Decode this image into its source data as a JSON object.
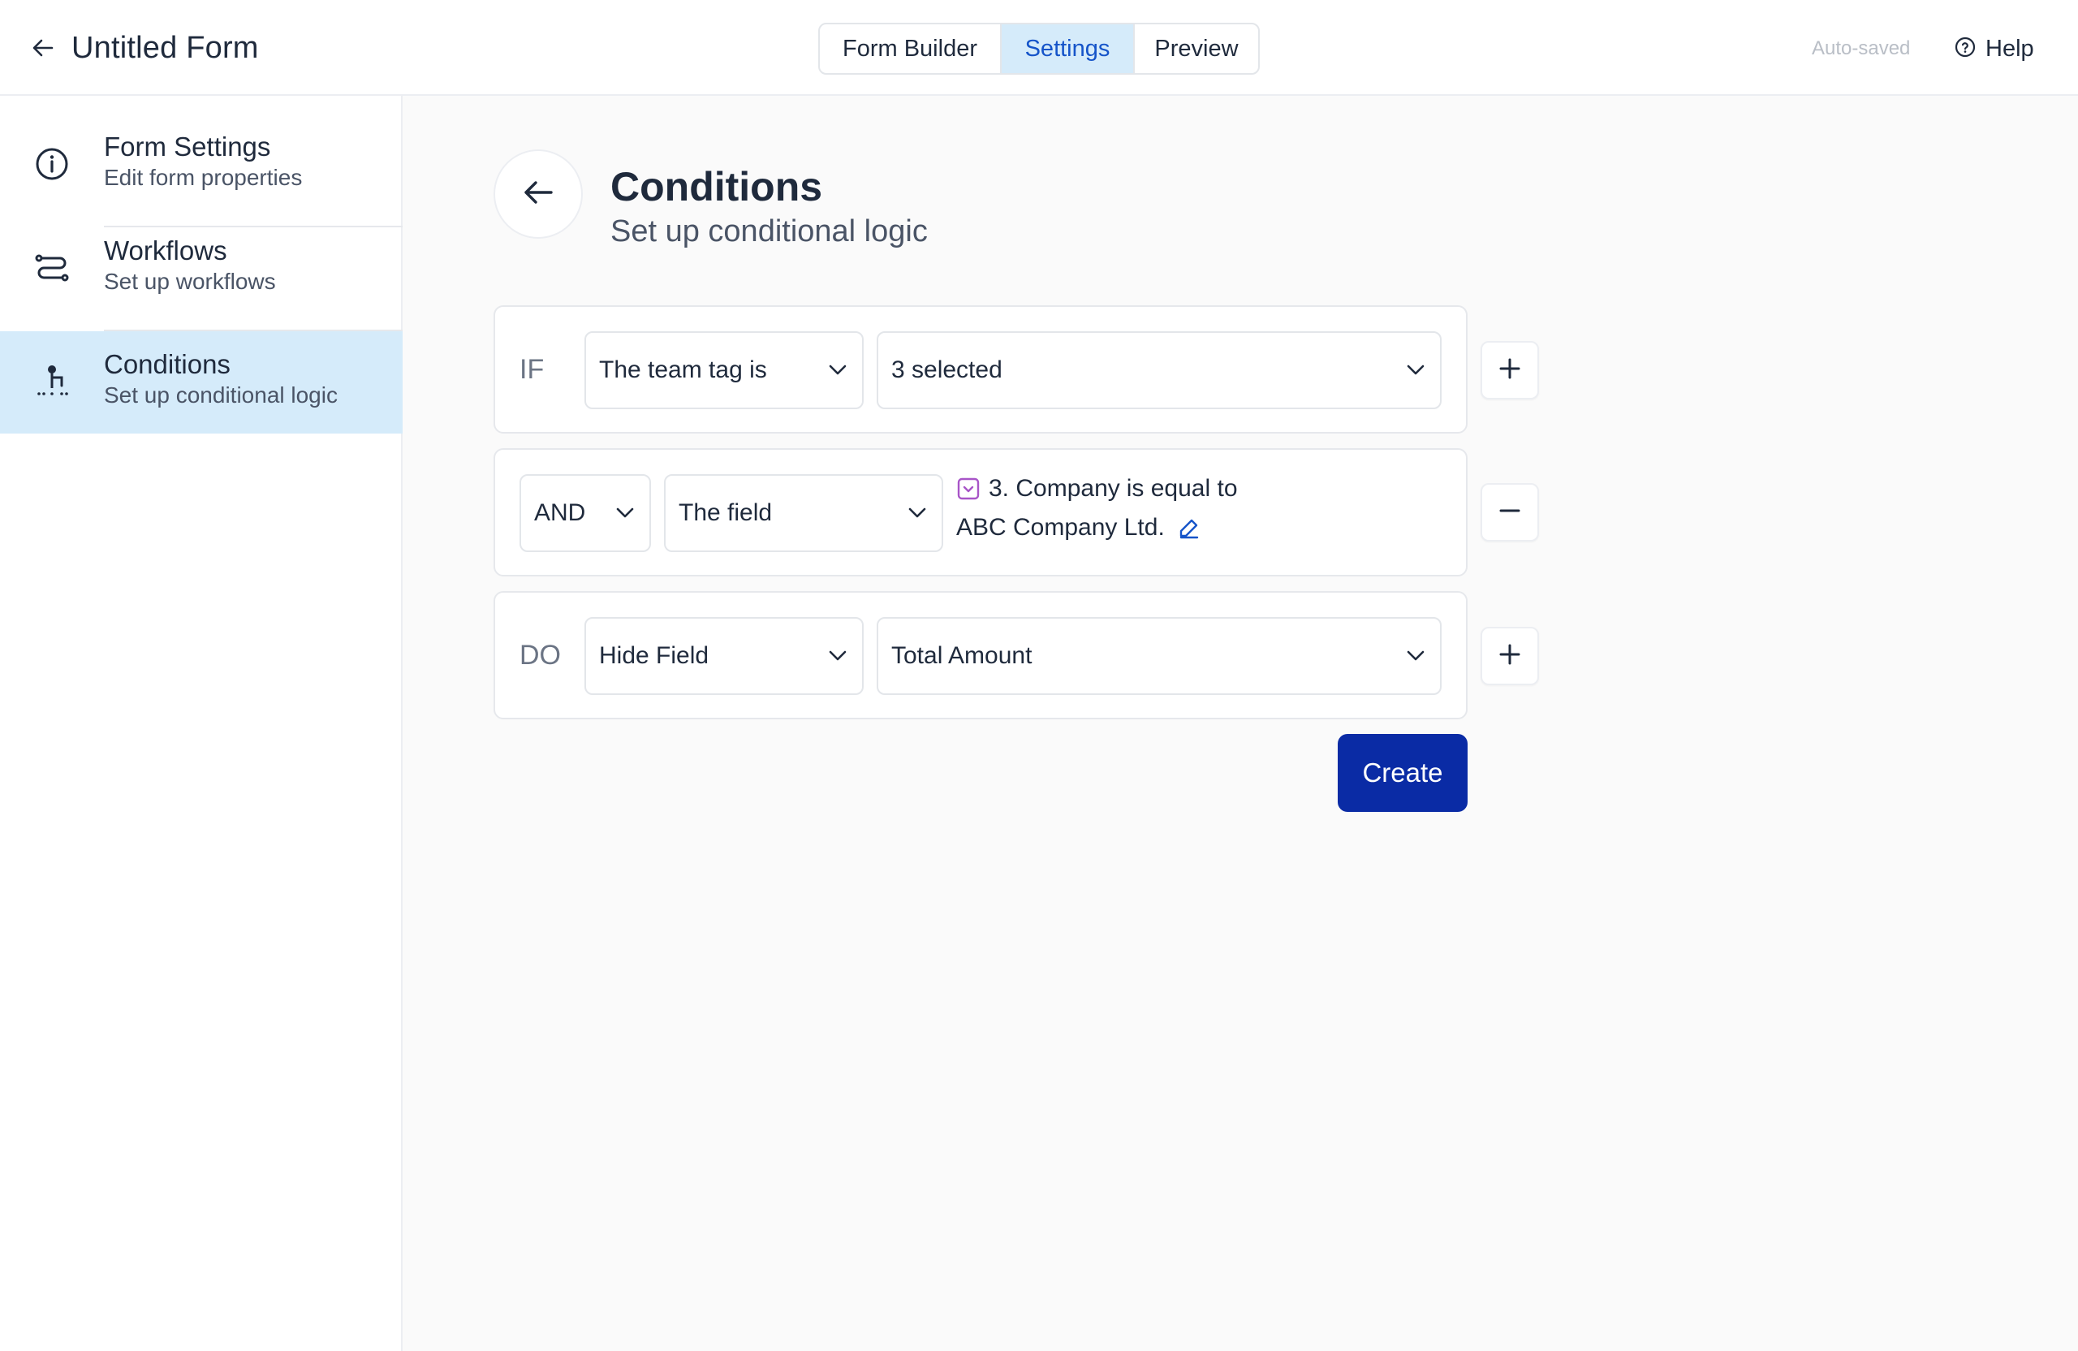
{
  "header": {
    "title": "Untitled Form",
    "tabs": [
      {
        "label": "Form Builder",
        "active": false
      },
      {
        "label": "Settings",
        "active": true
      },
      {
        "label": "Preview",
        "active": false
      }
    ],
    "status": "Auto-saved",
    "help_label": "Help"
  },
  "sidebar": {
    "items": [
      {
        "title": "Form Settings",
        "subtitle": "Edit form properties",
        "icon": "info-icon",
        "active": false
      },
      {
        "title": "Workflows",
        "subtitle": "Set up workflows",
        "icon": "workflow-icon",
        "active": false
      },
      {
        "title": "Conditions",
        "subtitle": "Set up conditional logic",
        "icon": "conditions-icon",
        "active": true
      }
    ]
  },
  "main": {
    "title": "Conditions",
    "subtitle": "Set up conditional logic",
    "rules": {
      "if": {
        "keyword": "IF",
        "operator": "The team tag is",
        "value": "3 selected"
      },
      "and": {
        "connector": "AND",
        "operator": "The field",
        "field_name": "3. Company",
        "comparison": "is equal to",
        "value": "ABC Company Ltd."
      },
      "do": {
        "keyword": "DO",
        "action": "Hide Field",
        "target": "Total Amount"
      }
    },
    "create_label": "Create"
  },
  "colors": {
    "accent": "#0a2ba5",
    "active_bg": "#d5ebfa",
    "active_text": "#1554c9",
    "field_icon": "#a855c8"
  }
}
